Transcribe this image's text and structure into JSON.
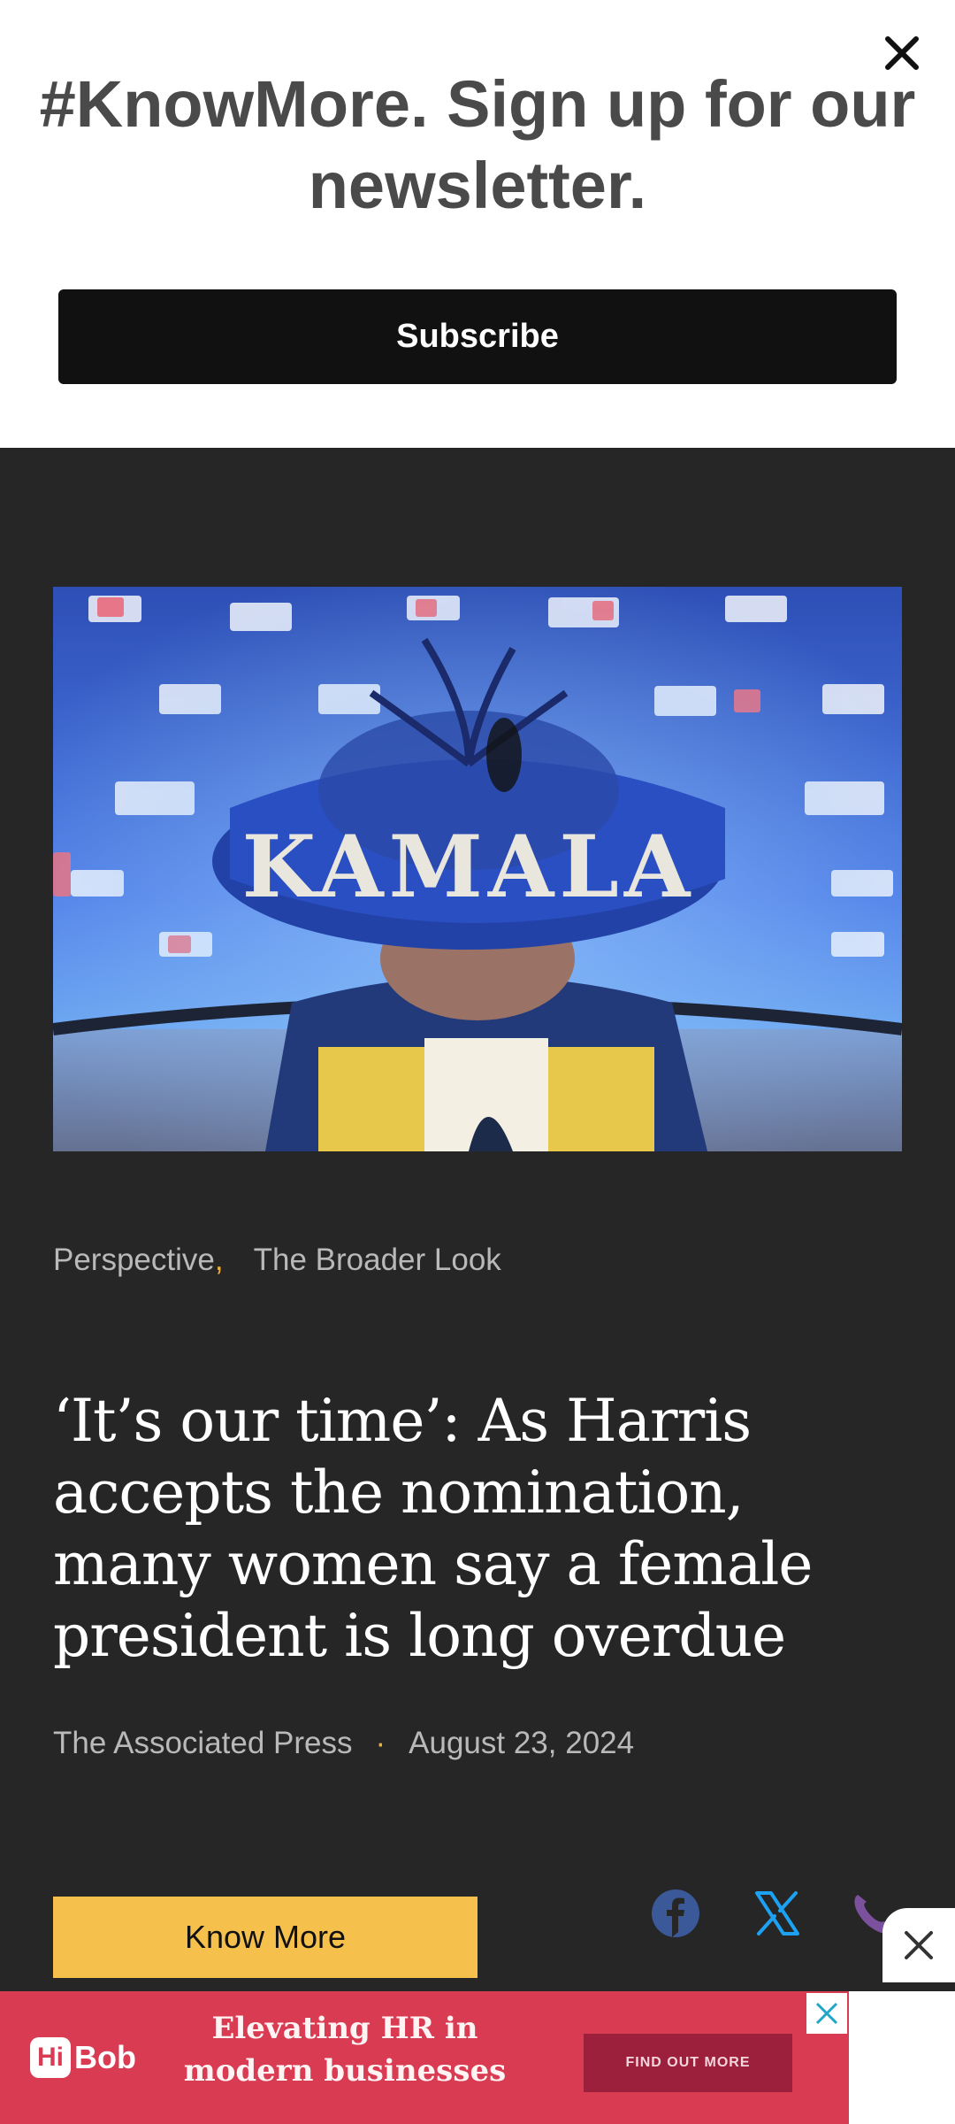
{
  "newsletter": {
    "title": "#KnowMore. Sign up for our newsletter.",
    "subscribe_label": "Subscribe",
    "close_icon": "close-icon"
  },
  "article": {
    "hero_image": "photo: woman wearing blue hat with 'KAMALA' in rhinestones",
    "hero_hat_text": "KAMALA",
    "tags": [
      "Perspective",
      "The Broader Look"
    ],
    "headline": "‘It’s our time’: As Harris accepts the nomination, many women say a female president is long overdue",
    "author": "The Associated Press",
    "date": "August 23, 2024",
    "know_more_label": "Know More",
    "share_icons": [
      "facebook-icon",
      "x-icon",
      "phone-icon"
    ]
  },
  "ad": {
    "brand": "HiBob",
    "brand_mark": "Hi",
    "brand_text": "Bob",
    "headline": "Elevating HR in modern businesses",
    "cta": "FIND OUT MORE",
    "close_icon": "close-icon"
  },
  "colors": {
    "background": "#262626",
    "accent": "#f0b13b",
    "button_yellow": "#f6c04d",
    "ad_background": "#d93b52",
    "facebook": "#3b5998",
    "x": "#1da1f2",
    "phone": "#7b519d"
  }
}
